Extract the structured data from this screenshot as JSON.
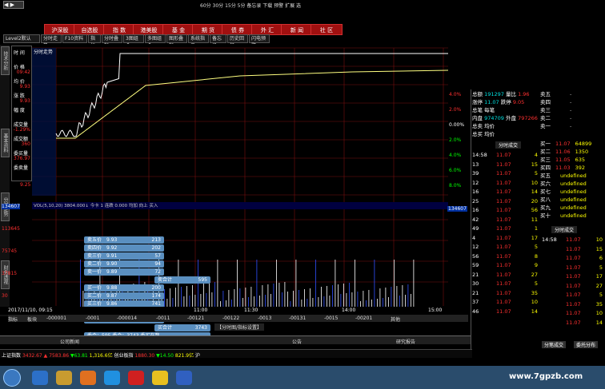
{
  "title_bar": {
    "menus": [
      "60分",
      "30分",
      "15分",
      "5分",
      "备忘录",
      "下载",
      "预警",
      "扩展",
      "选"
    ]
  },
  "nav_tabs": [
    "沪深股",
    "自选股",
    "指 数",
    "港美股",
    "基 金",
    "期 货",
    "债 券",
    "外 汇",
    "新 闻",
    "社 区"
  ],
  "toolbar": [
    "Level2默认",
    "分时走势",
    "F10资料",
    "指标",
    "分时叠加",
    "3图组合",
    "多图组合",
    "图形叠加",
    "系统指示",
    "备忘录",
    "历史回忆",
    "闪电预警"
  ],
  "left_sidebar": {
    "btns": [
      "技术分析",
      "基本资料",
      "分时走势",
      "财务透视"
    ]
  },
  "info_panel": {
    "title": "分时走势",
    "stock": "土兰薄",
    "labels": [
      "时 间",
      "价 格",
      "均 价",
      "涨 跌",
      "幅 度",
      "成交量",
      "成交额",
      "委买量",
      "委卖量"
    ],
    "values": [
      "",
      "09:42",
      "9.93",
      "9.93",
      "",
      "-1.29%",
      "360",
      "376.97"
    ]
  },
  "price_axis": {
    "left": [
      "9.25"
    ],
    "right_pct": [
      "4.0%",
      "2.0%",
      "0.00%",
      "2.0%",
      "4.0%",
      "6.0%",
      "8.0%"
    ]
  },
  "volume_panel": {
    "header": "VOL(5,10,20)  3804.000↓ 今卡  1 连跌  0.000  均加  向上  买入",
    "left_labels": [
      "134607",
      "113645",
      "75745",
      "37815",
      "30"
    ],
    "right_label": "134607"
  },
  "bid_ask_popup": {
    "header": [
      "卖五价",
      "卖四价",
      "卖三价",
      "卖二价",
      "卖一价"
    ],
    "sell": [
      [
        "卖五价",
        "9.93",
        "213"
      ],
      [
        "卖四价",
        "9.92",
        "202"
      ],
      [
        "卖三价",
        "9.91",
        "57"
      ],
      [
        "卖二价",
        "9.90",
        "94"
      ],
      [
        "卖一价",
        "9.89",
        "72"
      ]
    ],
    "sell_total": [
      "卖合计",
      "595"
    ],
    "buy": [
      [
        "买一价",
        "9.88",
        "200"
      ],
      [
        "买二价",
        "9.87",
        "174"
      ],
      [
        "买三价",
        "9.86",
        "741"
      ],
      [
        "买四价",
        "9.85",
        "1408"
      ],
      [
        "买五价",
        "9.84",
        "1230"
      ]
    ],
    "buy_total": [
      "买合计",
      "3743"
    ],
    "footer": [
      "委合：595",
      "委合：3743",
      "委买在数"
    ]
  },
  "bottom_axis": {
    "date": "2017/11/10, 09:15",
    "times": [
      "11:00",
      "11:30",
      "14:00",
      "15:00"
    ]
  },
  "bottom_tabs": [
    "指标",
    "板块",
    "-000001",
    "-0001",
    "-000014",
    "-0011",
    "-00121",
    "-00122",
    "-0013",
    "-00131",
    "-0015",
    "-00201",
    "其他"
  ],
  "bottom_bar": {
    "left": "公司新闻",
    "center": "公告",
    "right": "研究报告",
    "mid": "【分时图/指标设置】"
  },
  "quote_panel": {
    "rows": [
      [
        "总额",
        "191297",
        "量比",
        "1.96"
      ],
      [
        "涨停",
        "11.07",
        "跌停",
        "9.05"
      ],
      [
        "总笔",
        "",
        "每笔",
        ""
      ],
      [
        "内盘",
        "974709",
        "外盘",
        "797266"
      ],
      [
        "总卖",
        "",
        "均价",
        "",
        ""
      ],
      [
        "总买",
        "",
        "均价",
        ""
      ]
    ],
    "sell": [
      [
        "卖五",
        "-"
      ],
      [
        "卖四",
        "-"
      ],
      [
        "卖三",
        "-"
      ],
      [
        "卖二",
        "-"
      ],
      [
        "卖一",
        "-"
      ]
    ],
    "buy": [
      [
        "买一",
        "11.07",
        "64899"
      ],
      [
        "买二",
        "11.06",
        "1350"
      ],
      [
        "买三",
        "11.05",
        "635"
      ],
      [
        "买四",
        "11.03",
        "392"
      ],
      [
        "买五",
        ""
      ],
      [
        "买六",
        ""
      ],
      [
        "买七",
        ""
      ],
      [
        "买八",
        ""
      ],
      [
        "买九",
        ""
      ],
      [
        "买十",
        ""
      ]
    ],
    "ticks_title": "分时成交",
    "ticks": [
      [
        "14:58",
        "11.07",
        "4"
      ],
      [
        "13",
        "11.07",
        "15"
      ],
      [
        "39",
        "11.07",
        "5"
      ],
      [
        "12",
        "11.07",
        "10"
      ],
      [
        "16",
        "11.07",
        "14"
      ],
      [
        "25",
        "11.07",
        "20"
      ],
      [
        "16",
        "11.07",
        "56"
      ],
      [
        "42",
        "11.07",
        "11"
      ],
      [
        "49",
        "11.07",
        "1"
      ],
      [
        "4",
        "11.07",
        "17"
      ],
      [
        "12",
        "11.07",
        "5"
      ],
      [
        "56",
        "11.07",
        "8"
      ],
      [
        "59",
        "11.07",
        "9"
      ],
      [
        "21",
        "11.07",
        "27"
      ],
      [
        "30",
        "11.07",
        "5"
      ],
      [
        "21",
        "11.07",
        "35"
      ],
      [
        "37",
        "11.07",
        "10"
      ],
      [
        "46",
        "11.07",
        "14"
      ]
    ],
    "right_sell": [
      [
        "卖五",
        "-"
      ],
      [
        "卖四",
        "-"
      ],
      [
        "卖三",
        "-"
      ],
      [
        "卖二",
        "-"
      ],
      [
        "卖一",
        "-"
      ]
    ],
    "right_ticks": [
      [
        "14:58",
        "11.07",
        "10"
      ],
      [
        "",
        "11.07",
        "15"
      ],
      [
        "",
        "11.07",
        "6"
      ],
      [
        "",
        "11.07",
        "5"
      ],
      [
        "",
        "11.07",
        "17"
      ],
      [
        "",
        "11.07",
        "27"
      ],
      [
        "",
        "11.07",
        "5"
      ],
      [
        "",
        "11.07",
        "35"
      ],
      [
        "",
        "11.07",
        "10"
      ],
      [
        "",
        "11.07",
        "14"
      ]
    ],
    "tabs": [
      "分笔成交",
      "委托分布"
    ]
  },
  "index_bar": [
    [
      "上证指数",
      "3432.67",
      "▲",
      "7583.86",
      "▼63.81",
      "1,316.6亿",
      "创业板指",
      "1880.30",
      "▼14.50",
      "821.9亿",
      "沪"
    ]
  ],
  "taskbar": {
    "watermark": "www.7gpzb.com",
    "icons": [
      "start",
      "ie",
      "folder",
      "media",
      "media2",
      "app1",
      "app2",
      "app3"
    ]
  },
  "colors": {
    "bg": "#000000",
    "grid": "#8b1a1a",
    "red": "#ff3030",
    "green": "#00ff00",
    "yellow": "#ffff00"
  }
}
